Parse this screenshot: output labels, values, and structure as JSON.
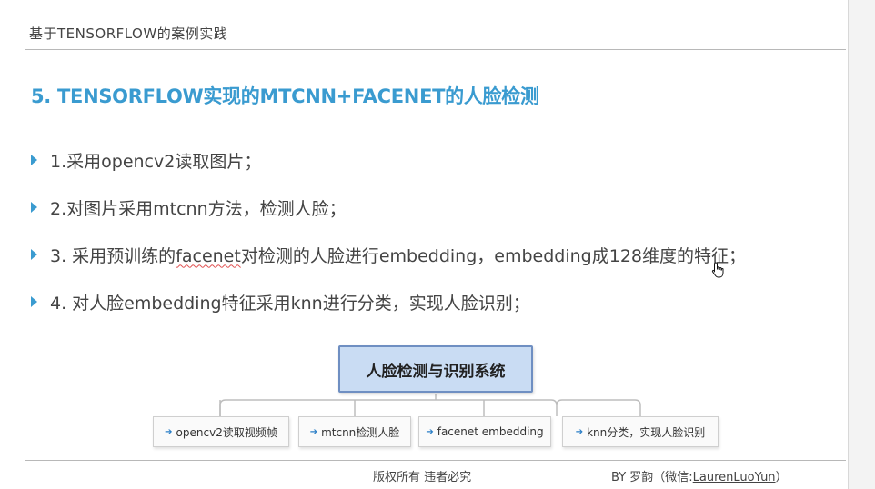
{
  "header": {
    "title": "基于TENSORFLOW的案例实践"
  },
  "slide": {
    "heading": "5. TENSORFLOW实现的MTCNN+FACENET的人脸检测",
    "bullets": [
      {
        "text": "1.采用opencv2读取图片；"
      },
      {
        "text": "2.对图片采用mtcnn方法，检测人脸；"
      },
      {
        "prefix": "3. 采用预训练的",
        "highlight": "facenet",
        "suffix": "对检测的人脸进行embedding，embedding成128维度的特征；"
      },
      {
        "text": "4. 对人脸embedding特征采用knn进行分类，实现人脸识别；"
      }
    ]
  },
  "diagram": {
    "root": "人脸检测与识别系统",
    "children": [
      {
        "label": "opencv2读取视频帧"
      },
      {
        "label": "mtcnn检测人脸"
      },
      {
        "label": "facenet embedding"
      },
      {
        "label": "knn分类，实现人脸识别"
      }
    ],
    "colors": {
      "root_fill": "#c9dcf3",
      "root_border": "#6f8fc2",
      "arrow": "#2b7fc7"
    }
  },
  "footer": {
    "copyright": "版权所有 违者必究",
    "author_prefix": "BY 罗韵（微信:",
    "author_handle": "LaurenLuoYun",
    "author_suffix": "）"
  },
  "colors": {
    "heading": "#3a9bd0",
    "bullet_marker": "#3a9bd0"
  }
}
